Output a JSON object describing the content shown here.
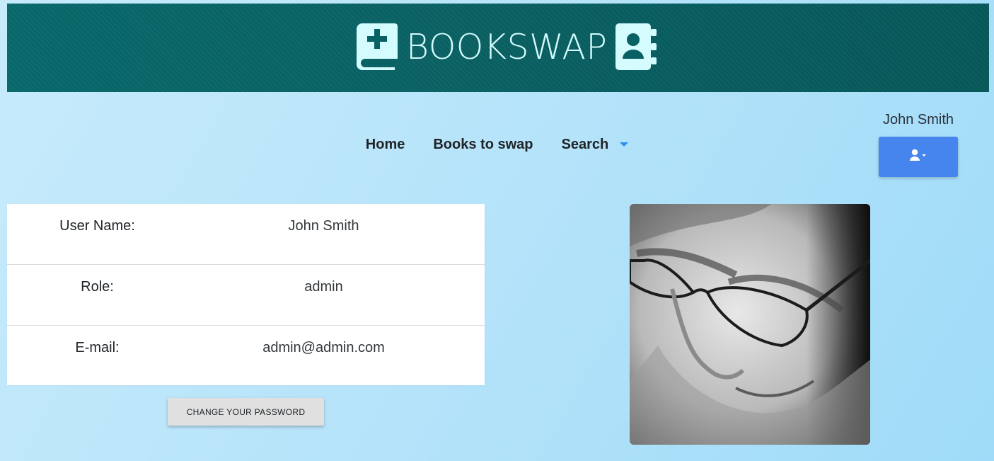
{
  "header": {
    "brand": "BOOKSWAP",
    "icons": {
      "left": "book-plus-icon",
      "right": "address-book-icon"
    },
    "colors": {
      "bar": "#086a6c",
      "logo": "#d4fbfd"
    }
  },
  "nav": {
    "items": [
      {
        "label": "Home"
      },
      {
        "label": "Books to swap"
      },
      {
        "label": "Search",
        "dropdown": true
      }
    ]
  },
  "user": {
    "name": "John Smith",
    "menu_icon": "user-icon",
    "button_color": "#4785ee"
  },
  "profile": {
    "fields": [
      {
        "label": "User Name:",
        "value": "John Smith"
      },
      {
        "label": "Role:",
        "value": "admin"
      },
      {
        "label": "E-mail:",
        "value": "admin@admin.com"
      }
    ],
    "change_password_label": "CHANGE YOUR PASSWORD"
  },
  "avatar": {
    "kind": "user-photo"
  }
}
